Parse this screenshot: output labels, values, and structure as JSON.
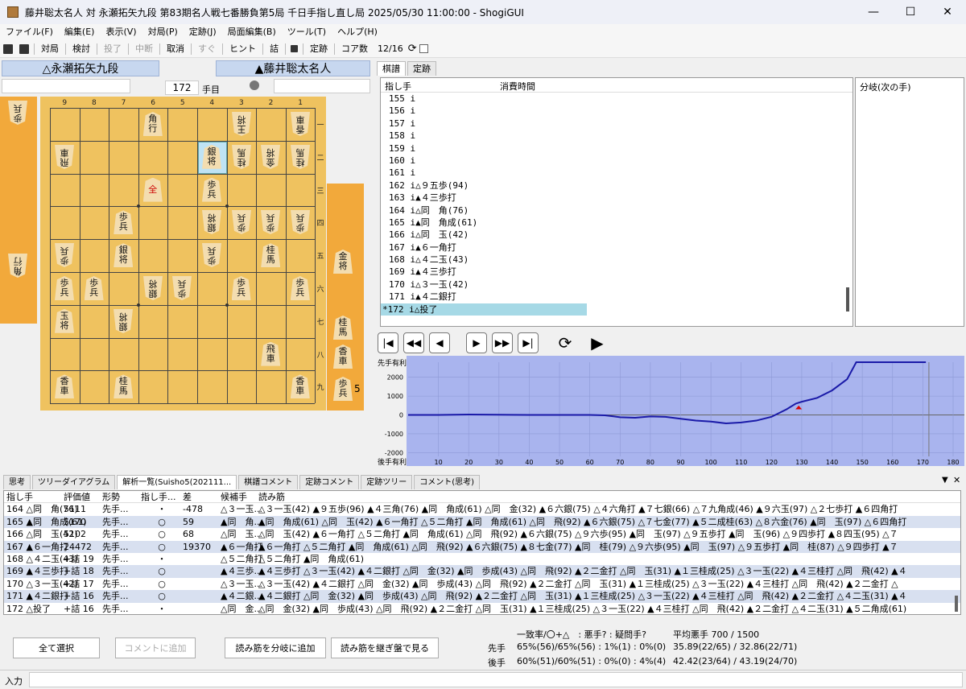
{
  "window": {
    "title": "藤井聡太名人 対 永瀬拓矢九段 第83期名人戦七番勝負第5局 千日手指し直し局 2025/05/30 11:00:00 - ShogiGUI",
    "min": "—",
    "max": "☐",
    "close": "✕"
  },
  "menu": [
    "ファイル(F)",
    "編集(E)",
    "表示(V)",
    "対局(P)",
    "定跡(J)",
    "局面編集(B)",
    "ツール(T)",
    "ヘルプ(H)"
  ],
  "toolbar": {
    "play": "対局",
    "study": "検討",
    "resign": "投了",
    "pause": "中断",
    "cancel": "取消",
    "now": "すぐ",
    "hint": "ヒント",
    "mate": "詰",
    "joseki": "定跡",
    "cores_label": "コア数",
    "cores_value": "12/16"
  },
  "players": {
    "gote": "△永瀬拓矢九段",
    "sente": "▲藤井聡太名人"
  },
  "move_counter": {
    "value": "172",
    "unit": "手目"
  },
  "board": {
    "files": [
      "9",
      "8",
      "7",
      "6",
      "5",
      "4",
      "3",
      "2",
      "1"
    ],
    "ranks": [
      "一",
      "二",
      "三",
      "四",
      "五",
      "六",
      "七",
      "八",
      "九"
    ],
    "pieces": [
      {
        "c": 4,
        "r": 1,
        "t": "角",
        "t2": "行",
        "inv": false,
        "promo": false
      },
      {
        "c": 7,
        "r": 1,
        "t": "王",
        "t2": "将",
        "inv": true,
        "promo": false
      },
      {
        "c": 9,
        "r": 1,
        "t": "香",
        "t2": "車",
        "inv": true,
        "promo": false
      },
      {
        "c": 1,
        "r": 2,
        "t": "飛",
        "t2": "車",
        "inv": true,
        "promo": false
      },
      {
        "c": 6,
        "r": 2,
        "t": "銀",
        "t2": "将",
        "inv": false,
        "promo": false,
        "hl": true
      },
      {
        "c": 7,
        "r": 2,
        "t": "桂",
        "t2": "馬",
        "inv": true,
        "promo": false
      },
      {
        "c": 8,
        "r": 2,
        "t": "金",
        "t2": "将",
        "inv": true,
        "promo": false
      },
      {
        "c": 9,
        "r": 2,
        "t": "桂",
        "t2": "馬",
        "inv": true,
        "promo": false
      },
      {
        "c": 4,
        "r": 3,
        "t": "全",
        "t2": "",
        "inv": false,
        "promo": true
      },
      {
        "c": 6,
        "r": 3,
        "t": "歩",
        "t2": "兵",
        "inv": false,
        "promo": false
      },
      {
        "c": 3,
        "r": 4,
        "t": "歩",
        "t2": "兵",
        "inv": false,
        "promo": false
      },
      {
        "c": 6,
        "r": 4,
        "t": "銀",
        "t2": "将",
        "inv": true,
        "promo": false
      },
      {
        "c": 7,
        "r": 4,
        "t": "歩",
        "t2": "兵",
        "inv": true,
        "promo": false
      },
      {
        "c": 8,
        "r": 4,
        "t": "歩",
        "t2": "兵",
        "inv": true,
        "promo": false
      },
      {
        "c": 9,
        "r": 4,
        "t": "歩",
        "t2": "兵",
        "inv": true,
        "promo": false
      },
      {
        "c": 1,
        "r": 5,
        "t": "歩",
        "t2": "兵",
        "inv": true,
        "promo": false
      },
      {
        "c": 3,
        "r": 5,
        "t": "銀",
        "t2": "将",
        "inv": false,
        "promo": false
      },
      {
        "c": 6,
        "r": 5,
        "t": "歩",
        "t2": "兵",
        "inv": true,
        "promo": false
      },
      {
        "c": 8,
        "r": 5,
        "t": "桂",
        "t2": "馬",
        "inv": false,
        "promo": false
      },
      {
        "c": 1,
        "r": 6,
        "t": "歩",
        "t2": "兵",
        "inv": false,
        "promo": false
      },
      {
        "c": 2,
        "r": 6,
        "t": "歩",
        "t2": "兵",
        "inv": false,
        "promo": false
      },
      {
        "c": 4,
        "r": 6,
        "t": "銀",
        "t2": "将",
        "inv": true,
        "promo": false
      },
      {
        "c": 5,
        "r": 6,
        "t": "歩",
        "t2": "兵",
        "inv": true,
        "promo": false
      },
      {
        "c": 7,
        "r": 6,
        "t": "歩",
        "t2": "兵",
        "inv": false,
        "promo": false
      },
      {
        "c": 9,
        "r": 6,
        "t": "歩",
        "t2": "兵",
        "inv": false,
        "promo": false
      },
      {
        "c": 1,
        "r": 7,
        "t": "玉",
        "t2": "将",
        "inv": false,
        "promo": false
      },
      {
        "c": 3,
        "r": 7,
        "t": "銀",
        "t2": "将",
        "inv": true,
        "promo": false
      },
      {
        "c": 8,
        "r": 8,
        "t": "飛",
        "t2": "車",
        "inv": false,
        "promo": false
      },
      {
        "c": 1,
        "r": 9,
        "t": "香",
        "t2": "車",
        "inv": false,
        "promo": false
      },
      {
        "c": 3,
        "r": 9,
        "t": "桂",
        "t2": "馬",
        "inv": false,
        "promo": false
      },
      {
        "c": 9,
        "r": 9,
        "t": "香",
        "t2": "車",
        "inv": false,
        "promo": false
      }
    ]
  },
  "gote_hand": [
    {
      "t": "歩",
      "t2": "兵",
      "inv": true
    },
    {
      "t": "角",
      "t2": "行",
      "inv": true
    }
  ],
  "sente_hand": [
    {
      "t": "金",
      "t2": "将"
    },
    {
      "t": "桂",
      "t2": "馬"
    },
    {
      "t": "香",
      "t2": "車"
    },
    {
      "t": "歩",
      "t2": "兵",
      "count": "5"
    }
  ],
  "kifu_tabs": [
    "棋譜",
    "定跡"
  ],
  "kifu_headers": {
    "move": "指し手",
    "time": "消費時間",
    "branch": "分岐(次の手)"
  },
  "kifu": [
    "155 i",
    "156 i",
    "157 i",
    "158 i",
    "159 i",
    "160 i",
    "161 i",
    "162 i△９五歩(94)",
    "163 i▲４三歩打",
    "164 i△同　角(76)",
    "165 i▲同　角成(61)",
    "166 i△同　玉(42)",
    "167 i▲６一角打",
    "168 i△４二玉(43)",
    "169 i▲４三歩打",
    "170 i△３一玉(42)",
    "171 i▲４二銀打",
    "*172 i△投了"
  ],
  "nav": [
    "|◀",
    "◀◀",
    "◀",
    "▶",
    "▶▶",
    "▶|",
    "⟳",
    "▶"
  ],
  "graph": {
    "top_label": "先手有利",
    "bottom_label": "後手有利",
    "yticks": [
      "2000",
      "1000",
      "0",
      "-1000",
      "-2000"
    ],
    "xticks": [
      "10",
      "20",
      "30",
      "40",
      "50",
      "60",
      "70",
      "80",
      "90",
      "100",
      "110",
      "120",
      "130",
      "140",
      "150",
      "160",
      "170",
      "180"
    ]
  },
  "chart_data": {
    "type": "line",
    "x": [
      0,
      10,
      20,
      30,
      40,
      50,
      60,
      65,
      70,
      75,
      80,
      85,
      90,
      95,
      100,
      105,
      110,
      115,
      120,
      125,
      128,
      130,
      135,
      140,
      145,
      148,
      150,
      160,
      171
    ],
    "y": [
      0,
      0,
      20,
      10,
      0,
      0,
      0,
      -20,
      -120,
      -150,
      -80,
      -100,
      -200,
      -300,
      -350,
      -450,
      -400,
      -300,
      -100,
      300,
      600,
      700,
      900,
      1300,
      1900,
      2800,
      2800,
      2800,
      2800
    ],
    "ylim": [
      -2200,
      2800
    ],
    "xlim": [
      0,
      180
    ],
    "color": "#1a1aa8"
  },
  "bottom_tabs": [
    "思考",
    "ツリーダイアグラム",
    "解析一覧(Suisho5(202111...",
    "棋譜コメント",
    "定跡コメント",
    "定跡ツリー",
    "コメント(思考)"
  ],
  "analysis_header": [
    "指し手",
    "評価値",
    "形勢",
    "指し手...",
    "差",
    "候補手",
    "読み筋"
  ],
  "analysis": [
    [
      "164 △同　角(76)",
      "5111",
      "先手...",
      "・",
      "-478",
      "△３一玉...",
      "△３一玉(42) ▲９五歩(96) ▲４三角(76) ▲同　角成(61) △同　金(32) ▲６六銀(75) △４六角打 ▲７七銀(66) △７九角成(46) ▲９六玉(97) △２七歩打 ▲６四角打"
    ],
    [
      "165 ▲同　角成(61)",
      "5170",
      "先手...",
      "○",
      "59",
      "▲同　角...",
      "▲同　角成(61) △同　玉(42) ▲６一角打 △５二角打 ▲同　角成(61) △同　飛(92) ▲６六銀(75) △７七金(77) ▲５二成桂(63) △８六金(76) ▲同　玉(97) △６四角打"
    ],
    [
      "166 △同　玉(42)",
      "5102",
      "先手...",
      "○",
      "68",
      "△同　玉...",
      "△同　玉(42) ▲６一角打 △５二角打 ▲同　角成(61) △同　飛(92) ▲６六銀(75) △９六歩(95) ▲同　玉(97) △９五歩打 ▲同　玉(96) △９四歩打 ▲８四玉(95) △７"
    ],
    [
      "167 ▲６一角打",
      "24472",
      "先手...",
      "○",
      "19370",
      "▲６一角打",
      "▲６一角打 △５二角打 ▲同　角成(61) △同　飛(92) ▲６六銀(75) ▲８七金(77) ▲同　桂(79) △９六歩(95) ▲同　玉(97) △９五歩打 ▲同　桂(87) △９四歩打 ▲７"
    ],
    [
      "168 △４二玉(43)",
      "+詰 19",
      "先手...",
      "・",
      "",
      "△５二角打",
      "△５二角打 ▲同　角成(61)"
    ],
    [
      "169 ▲４三歩打",
      "+詰 18",
      "先手...",
      "○",
      "",
      "▲４三歩...",
      "▲４三歩打 △３一玉(42) ▲４二銀打 △同　金(32) ▲同　歩成(43) △同　飛(92) ▲２二金打 △同　玉(31) ▲１三桂成(25) △３一玉(22) ▲４三桂打 △同　飛(42) ▲４"
    ],
    [
      "170 △３一玉(42)",
      "+詰 17",
      "先手...",
      "○",
      "",
      "△３一玉...",
      "△３一玉(42) ▲４二銀打 △同　金(32) ▲同　歩成(43) △同　飛(92) ▲２二金打 △同　玉(31) ▲１三桂成(25) △３一玉(22) ▲４三桂打 △同　飛(42) ▲２二金打 △"
    ],
    [
      "171 ▲４二銀打",
      "+詰 16",
      "先手...",
      "○",
      "",
      "▲４二銀...",
      "▲４二銀打 △同　金(32) ▲同　歩成(43) △同　飛(92) ▲２二金打 △同　玉(31) ▲１三桂成(25) △３一玉(22) ▲４三桂打 △同　飛(42) ▲２二金打 △４二玉(31) ▲４"
    ],
    [
      "172 △投了",
      "+詰 16",
      "先手...",
      "・",
      "",
      "△同　金...",
      "△同　金(32) ▲同　歩成(43) △同　飛(92) ▲２二金打 △同　玉(31) ▲１三桂成(25) △３一玉(22) ▲４三桂打 △同　飛(42) ▲２二金打 △４二玉(31) ▲５二角成(61)"
    ]
  ],
  "buttons": {
    "select_all": "全て選択",
    "add_comment": "コメントに追加",
    "add_branch": "読み筋を分岐に追加",
    "continue_board": "読み筋を継ぎ盤で見る"
  },
  "stats": {
    "header": "一致率/〇+△　: 悪手? : 疑問手?",
    "avg_header": "平均悪手 700 / 1500",
    "sente_label": "先手",
    "sente_vals": "65%(56)/65%(56) : 1%(1) : 0%(0)",
    "sente_avg": "35.89(22/65) / 32.86(22/71)",
    "gote_label": "後手",
    "gote_vals": "60%(51)/60%(51) : 0%(0) : 4%(4)",
    "gote_avg": "42.42(23/64) / 43.19(24/70)"
  },
  "input_label": "入力"
}
